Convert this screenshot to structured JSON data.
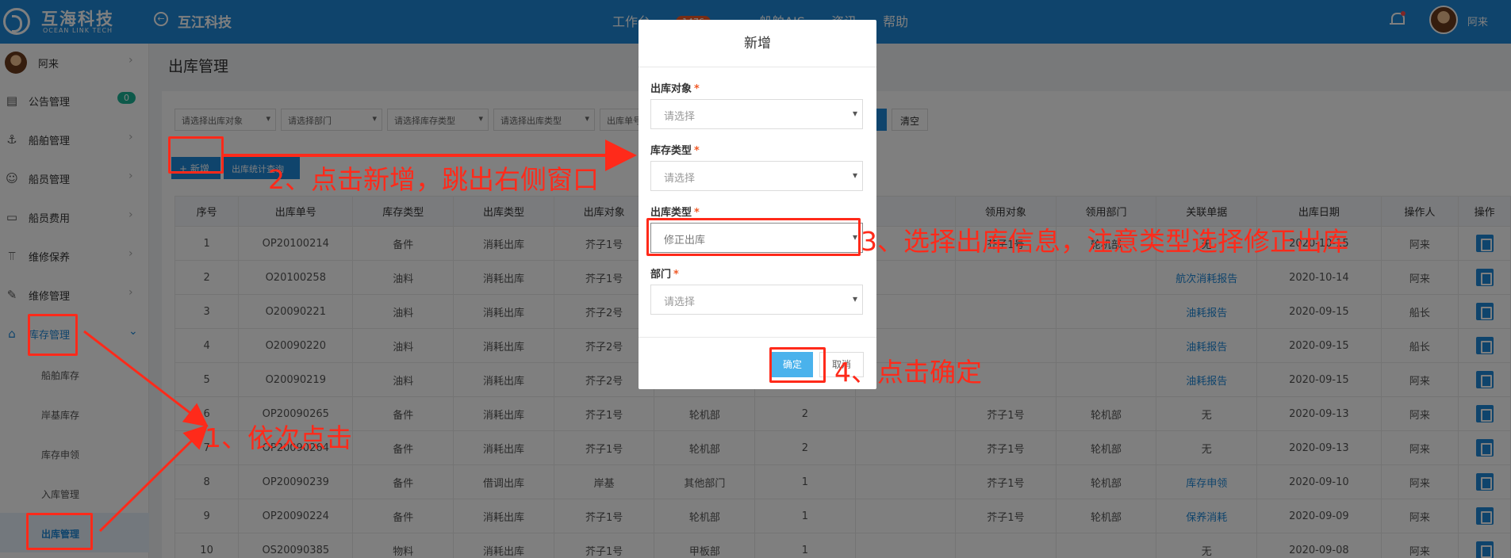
{
  "header": {
    "logo_cn": "互海科技",
    "logo_en": "OCEAN LINK TECH",
    "company": "互江科技",
    "nav": [
      {
        "label": "工作台",
        "badge": "1476"
      },
      {
        "label": "船舶AIS"
      },
      {
        "label": "资讯"
      },
      {
        "label": "帮助"
      }
    ],
    "user": "阿来"
  },
  "sidebar": {
    "user": "阿来",
    "items": [
      {
        "label": "公告管理",
        "badge": "0"
      },
      {
        "label": "船舶管理"
      },
      {
        "label": "船员管理"
      },
      {
        "label": "船员费用"
      },
      {
        "label": "维修保养"
      },
      {
        "label": "维修管理"
      },
      {
        "label": "库存管理"
      }
    ],
    "sub_items": [
      "船舶库存",
      "岸基库存",
      "库存申领",
      "入库管理",
      "出库管理"
    ]
  },
  "page": {
    "title": "出库管理",
    "filters": [
      "请选择出库对象",
      "请选择部门",
      "请选择库存类型",
      "请选择出库类型",
      "出库单号"
    ],
    "clear_label": "清空",
    "add_label": "+ 新增",
    "stat_label": "出库统计查询"
  },
  "table": {
    "headers": [
      "序号",
      "出库单号",
      "库存类型",
      "出库类型",
      "出库对象",
      "",
      "",
      "",
      "领用对象",
      "领用部门",
      "关联单据",
      "出库日期",
      "操作人",
      "操作"
    ],
    "rows": [
      [
        "1",
        "OP20100214",
        "备件",
        "消耗出库",
        "芥子1号",
        "",
        "",
        "",
        "芥子1号",
        "轮机部",
        "无",
        "2020-10-15",
        "阿来"
      ],
      [
        "2",
        "O20100258",
        "油料",
        "消耗出库",
        "芥子1号",
        "",
        "",
        "",
        "",
        "",
        "航次消耗报告",
        "2020-10-14",
        "阿来"
      ],
      [
        "3",
        "O20090221",
        "油料",
        "消耗出库",
        "芥子2号",
        "",
        "",
        "",
        "",
        "",
        "油耗报告",
        "2020-09-15",
        "船长"
      ],
      [
        "4",
        "O20090220",
        "油料",
        "消耗出库",
        "芥子2号",
        "",
        "",
        "",
        "",
        "",
        "油耗报告",
        "2020-09-15",
        "船长"
      ],
      [
        "5",
        "O20090219",
        "油料",
        "消耗出库",
        "芥子2号",
        "",
        "",
        "",
        "",
        "",
        "油耗报告",
        "2020-09-15",
        "阿来"
      ],
      [
        "6",
        "OP20090265",
        "备件",
        "消耗出库",
        "芥子1号",
        "轮机部",
        "2",
        "",
        "芥子1号",
        "轮机部",
        "无",
        "2020-09-13",
        "阿来"
      ],
      [
        "7",
        "OP20090264",
        "备件",
        "消耗出库",
        "芥子1号",
        "轮机部",
        "2",
        "",
        "芥子1号",
        "轮机部",
        "无",
        "2020-09-13",
        "阿来"
      ],
      [
        "8",
        "OP20090239",
        "备件",
        "借调出库",
        "岸基",
        "其他部门",
        "1",
        "",
        "芥子1号",
        "轮机部",
        "库存申领",
        "2020-09-10",
        "阿来"
      ],
      [
        "9",
        "OP20090224",
        "备件",
        "消耗出库",
        "芥子1号",
        "轮机部",
        "1",
        "",
        "芥子1号",
        "轮机部",
        "保养消耗",
        "2020-09-09",
        "阿来"
      ],
      [
        "10",
        "OS20090385",
        "物料",
        "消耗出库",
        "芥子1号",
        "甲板部",
        "1",
        "",
        "",
        "",
        "无",
        "2020-09-08",
        "阿来"
      ]
    ]
  },
  "modal": {
    "title": "新增",
    "fields": [
      {
        "label": "出库对象",
        "value": "请选择"
      },
      {
        "label": "库存类型",
        "value": "请选择"
      },
      {
        "label": "出库类型",
        "value": "修正出库"
      },
      {
        "label": "部门",
        "value": "请选择"
      }
    ],
    "ok_label": "确定",
    "cancel_label": "取消"
  },
  "annotations": {
    "step1": "1、依次点击",
    "step2": "2、点击新增，跳出右侧窗口",
    "step3": "3、选择出库信息，注意类型选择修正出库",
    "step4": "4、点击确定",
    "color": "#ff2a1a"
  }
}
